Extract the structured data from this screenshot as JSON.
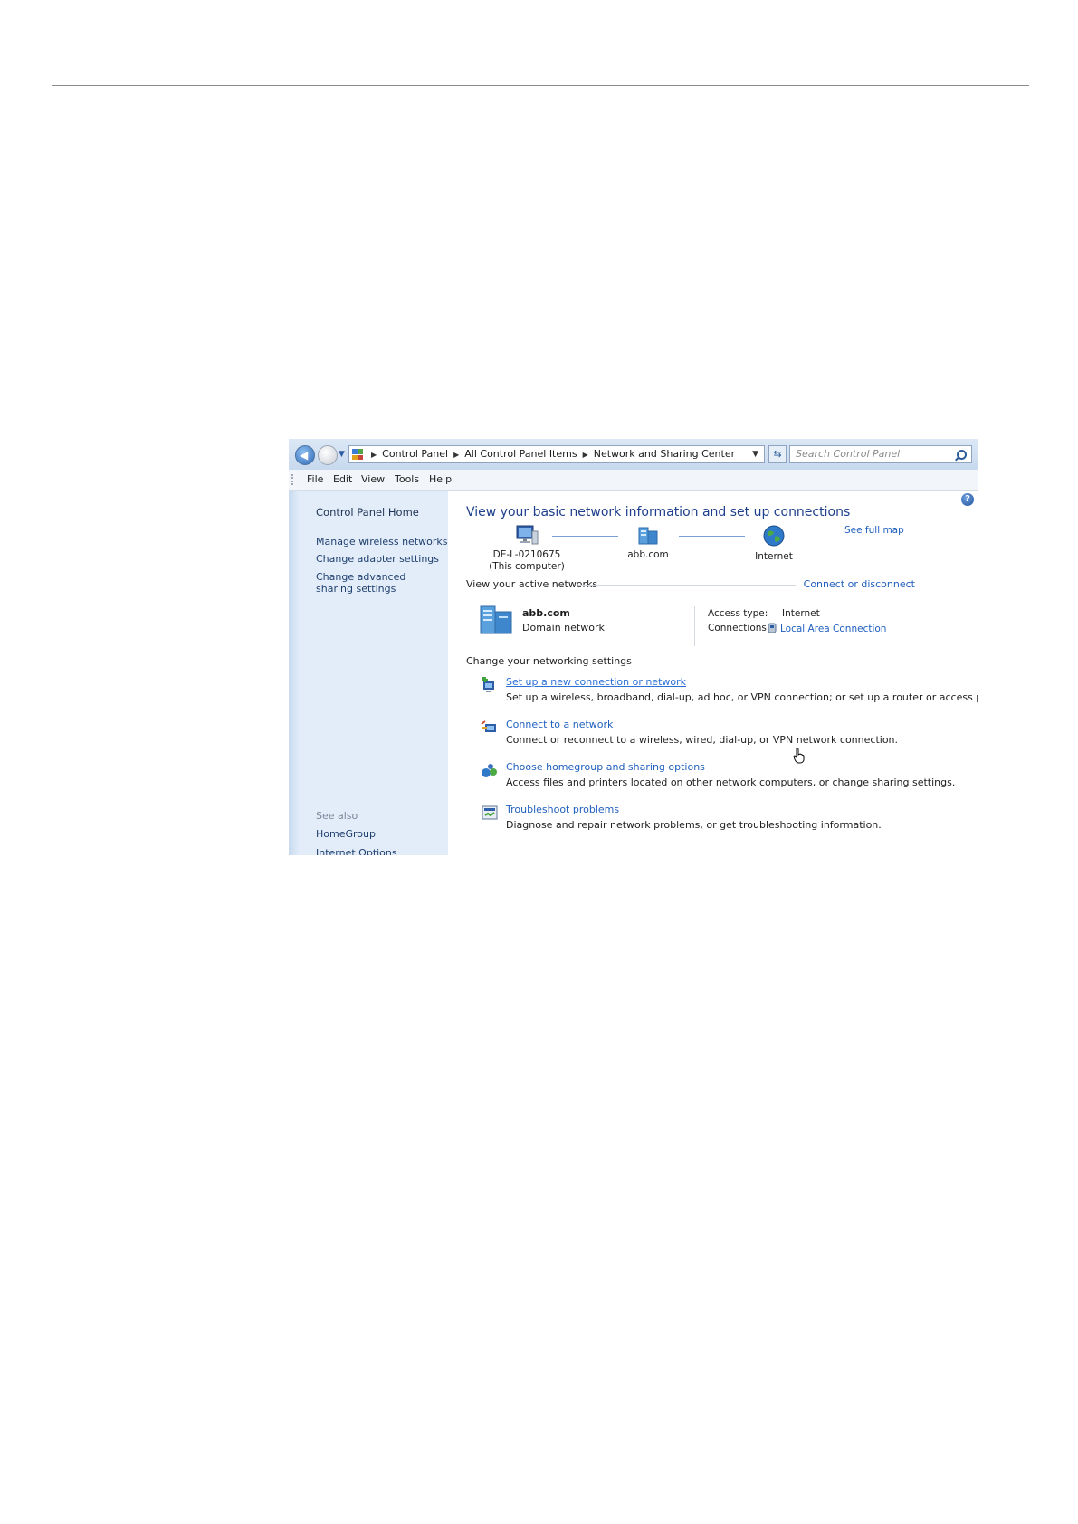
{
  "address_bar": {
    "breadcrumbs": [
      "Control Panel",
      "All Control Panel Items",
      "Network and Sharing Center"
    ],
    "search_placeholder": "Search Control Panel"
  },
  "menu": [
    "File",
    "Edit",
    "View",
    "Tools",
    "Help"
  ],
  "sidebar": {
    "home": "Control Panel Home",
    "links": [
      "Manage wireless networks",
      "Change adapter settings",
      "Change advanced sharing settings"
    ],
    "see_also_heading": "See also",
    "see_also": [
      "HomeGroup",
      "Internet Options"
    ]
  },
  "main": {
    "title": "View your basic network information and set up connections",
    "see_full_map": "See full map",
    "nodes": [
      {
        "line1": "DE-L-0210675",
        "line2": "(This computer)"
      },
      {
        "line1": "abb.com",
        "line2": ""
      },
      {
        "line1": "Internet",
        "line2": ""
      }
    ],
    "active_networks_heading": "View your active networks",
    "connect_or_disconnect": "Connect or disconnect",
    "network": {
      "name": "abb.com",
      "type": "Domain network",
      "access_type_label": "Access type:",
      "access_type_value": "Internet",
      "connections_label": "Connections:",
      "connections_value": "Local Area Connection"
    },
    "change_settings_heading": "Change your networking settings",
    "tasks": [
      {
        "title": "Set up a new connection or network",
        "desc": "Set up a wireless, broadband, dial-up, ad hoc, or VPN connection; or set up a router or access point."
      },
      {
        "title": "Connect to a network",
        "desc": "Connect or reconnect to a wireless, wired, dial-up, or VPN network connection."
      },
      {
        "title": "Choose homegroup and sharing options",
        "desc": "Access files and printers located on other network computers, or change sharing settings."
      },
      {
        "title": "Troubleshoot problems",
        "desc": "Diagnose and repair network problems, or get troubleshooting information."
      }
    ]
  },
  "colors": {
    "link": "#1f5fbf",
    "title": "#1e3f8c",
    "sidebar": "#e3edf9"
  }
}
